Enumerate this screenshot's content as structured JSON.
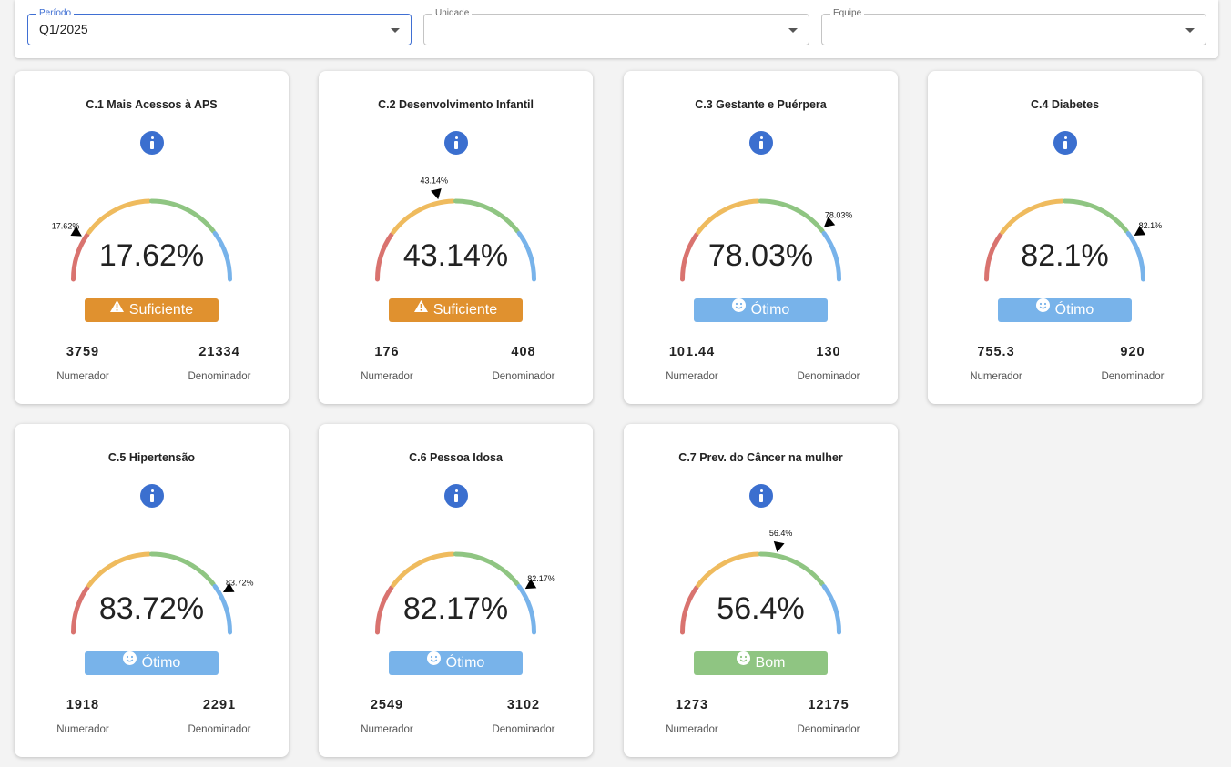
{
  "filters": {
    "periodo": {
      "label": "Período",
      "value": "Q1/2025"
    },
    "unidade": {
      "label": "Unidade",
      "value": ""
    },
    "equipe": {
      "label": "Equipe",
      "value": ""
    }
  },
  "colors": {
    "red": "#d9736f",
    "yellow": "#efbb5e",
    "green": "#8fc582",
    "blue": "#78b3ea",
    "warning": "#e0912f",
    "info": "#3b6fcf"
  },
  "labels": {
    "numerator": "Numerador",
    "denominator": "Denominador"
  },
  "cards": [
    {
      "title": "C.1 Mais Acessos à APS",
      "value": 17.62,
      "display": "17.62%",
      "marker": "17.62%",
      "status": "Suficiente",
      "status_color": "#e0912f",
      "status_icon": "warning-icon",
      "numerator": "3759",
      "denominator": "21334"
    },
    {
      "title": "C.2 Desenvolvimento Infantil",
      "value": 43.14,
      "display": "43.14%",
      "marker": "43.14%",
      "status": "Suficiente",
      "status_color": "#e0912f",
      "status_icon": "warning-icon",
      "numerator": "176",
      "denominator": "408"
    },
    {
      "title": "C.3 Gestante e Puérpera",
      "value": 78.03,
      "display": "78.03%",
      "marker": "78.03%",
      "status": "Ótimo",
      "status_color": "#78b3ea",
      "status_icon": "smile-icon",
      "numerator": "101.44",
      "denominator": "130"
    },
    {
      "title": "C.4 Diabetes",
      "value": 82.1,
      "display": "82.1%",
      "marker": "82.1%",
      "status": "Ótimo",
      "status_color": "#78b3ea",
      "status_icon": "smile-icon",
      "numerator": "755.3",
      "denominator": "920"
    },
    {
      "title": "C.5 Hipertensão",
      "value": 83.72,
      "display": "83.72%",
      "marker": "83.72%",
      "status": "Ótimo",
      "status_color": "#78b3ea",
      "status_icon": "smile-icon",
      "numerator": "1918",
      "denominator": "2291"
    },
    {
      "title": "C.6 Pessoa Idosa",
      "value": 82.17,
      "display": "82.17%",
      "marker": "82.17%",
      "status": "Ótimo",
      "status_color": "#78b3ea",
      "status_icon": "smile-icon",
      "numerator": "2549",
      "denominator": "3102"
    },
    {
      "title": "C.7 Prev. do Câncer na mulher",
      "value": 56.4,
      "display": "56.4%",
      "marker": "56.4%",
      "status": "Bom",
      "status_color": "#8fc582",
      "status_icon": "smile-icon",
      "numerator": "1273",
      "denominator": "12175"
    }
  ]
}
